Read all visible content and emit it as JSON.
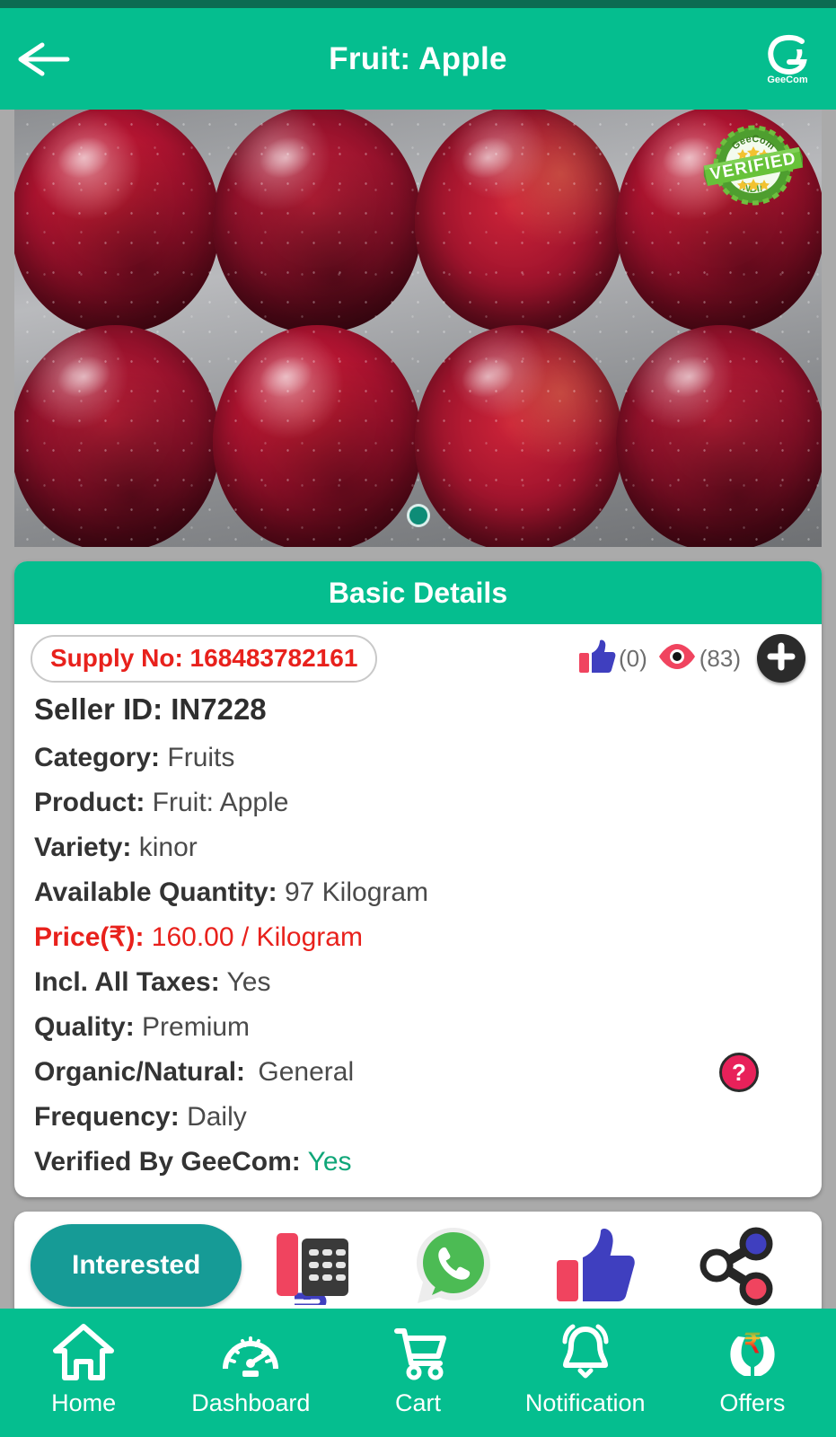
{
  "header": {
    "title": "Fruit: Apple",
    "back_icon": "arrow-left-icon",
    "brand_name": "GeeCom",
    "brand_icon": "geecom-logo-icon",
    "background_color": "#05BE8F"
  },
  "hero": {
    "verified_badge": {
      "top_text": "GeeCom",
      "main_text": "VERIFIED",
      "bottom_text": "INDIA"
    },
    "carousel": {
      "total_dots": 1,
      "active_index": 0
    }
  },
  "basic_details": {
    "section_title": "Basic Details",
    "supply_no": "Supply No: 168483782161",
    "likes": {
      "icon": "thumbs-up-icon",
      "count": "(0)"
    },
    "views": {
      "icon": "eye-icon",
      "count": "(83)"
    },
    "add_button_icon": "plus-icon",
    "help_button": {
      "icon": "question-mark-icon",
      "label": "?"
    },
    "seller": {
      "label": "Seller ID:",
      "value": "IN7228"
    },
    "rows": [
      {
        "label": "Category:",
        "value": "Fruits"
      },
      {
        "label": "Product:",
        "value": "Fruit: Apple"
      },
      {
        "label": "Variety:",
        "value": "kinor"
      },
      {
        "label": "Available Quantity:",
        "value": "97 Kilogram"
      },
      {
        "label": "Price(₹):",
        "value": "160.00 / Kilogram"
      },
      {
        "label": "Incl. All Taxes:",
        "value": "Yes"
      },
      {
        "label": "Quality:",
        "value": "Premium"
      },
      {
        "label": "Organic/Natural:",
        "value": "General"
      },
      {
        "label": "Frequency:",
        "value": "Daily"
      },
      {
        "label": "Verified By GeeCom:",
        "value": "Yes"
      }
    ],
    "colors": {
      "header_green": "#05BE8F",
      "price_red": "#E8211C",
      "verified_green": "#0FA678",
      "supply_red": "#E8211C"
    }
  },
  "actions": {
    "interested_label": "Interested",
    "interested_color": "#169B96",
    "icons": [
      {
        "name": "telephone-icon",
        "label": "Call"
      },
      {
        "name": "whatsapp-icon",
        "label": "WhatsApp"
      },
      {
        "name": "thumbs-up-icon",
        "label": "Like"
      },
      {
        "name": "share-icon",
        "label": "Share"
      }
    ]
  },
  "bottom_nav": {
    "items": [
      {
        "label": "Home",
        "icon": "home-icon"
      },
      {
        "label": "Dashboard",
        "icon": "speedometer-icon"
      },
      {
        "label": "Cart",
        "icon": "shopping-cart-icon"
      },
      {
        "label": "Notification",
        "icon": "bell-icon"
      },
      {
        "label": "Offers",
        "icon": "hands-rupee-icon"
      }
    ],
    "background_color": "#05BE8F"
  }
}
